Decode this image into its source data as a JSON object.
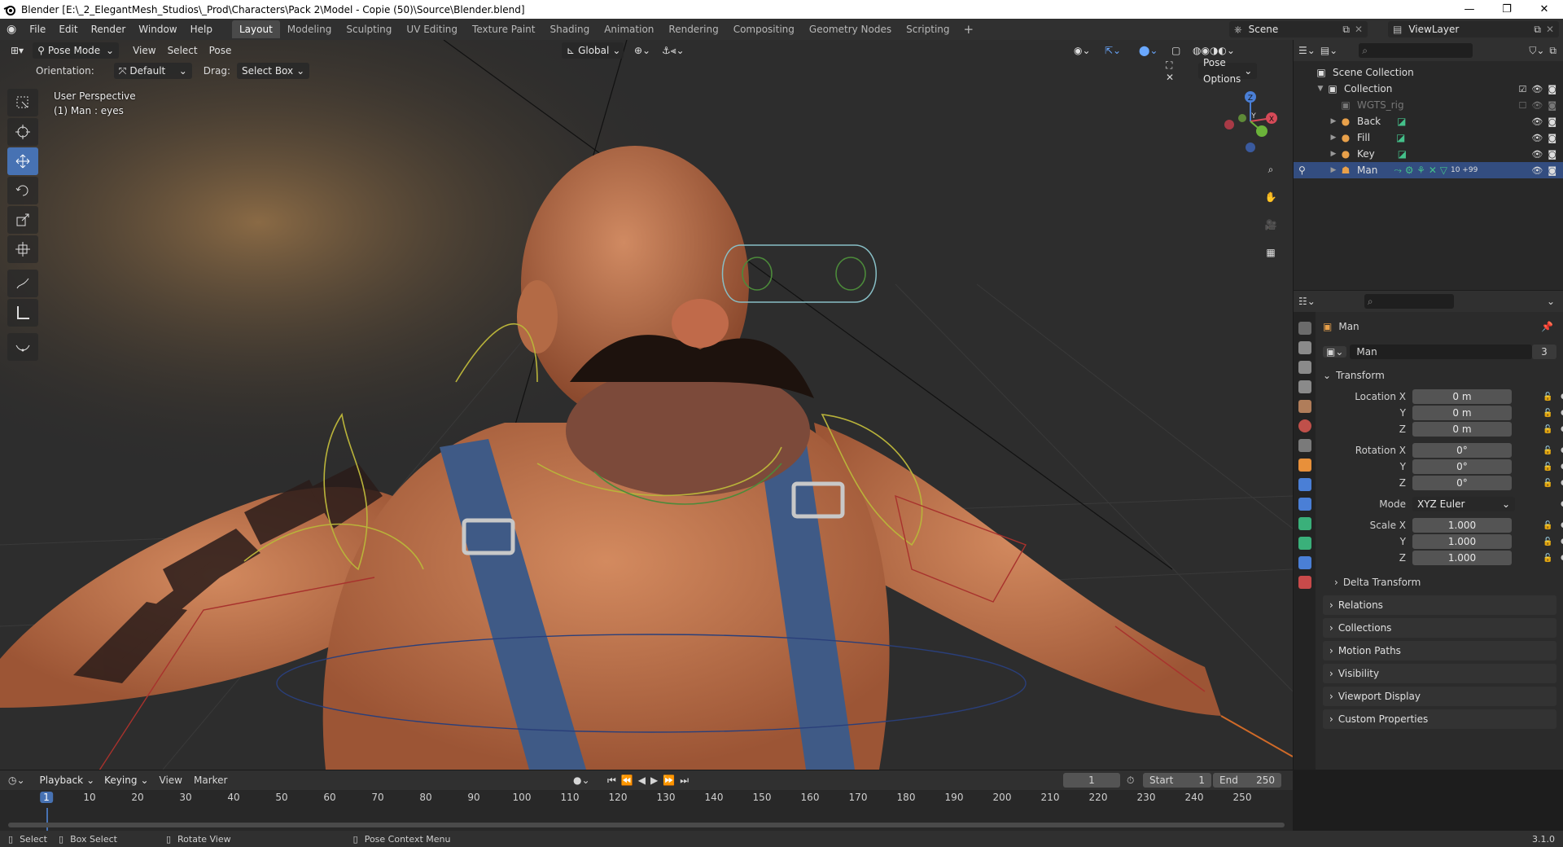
{
  "window": {
    "title": "Blender [E:\\_2_ElegantMesh_Studios\\_Prod\\Characters\\Pack 2\\Model - Copie (50)\\Source\\Blender.blend]",
    "buttons": [
      "—",
      "❐",
      "✕"
    ]
  },
  "menu": [
    "File",
    "Edit",
    "Render",
    "Window",
    "Help"
  ],
  "workspaces": [
    "Layout",
    "Modeling",
    "Sculpting",
    "UV Editing",
    "Texture Paint",
    "Shading",
    "Animation",
    "Rendering",
    "Compositing",
    "Geometry Nodes",
    "Scripting"
  ],
  "active_workspace": "Layout",
  "scene": {
    "name": "Scene",
    "view_layer": "ViewLayer"
  },
  "viewport_header": {
    "mode": "Pose Mode",
    "items": [
      "View",
      "Select",
      "Pose"
    ],
    "orientation_global": "Global",
    "pose_options": "Pose Options"
  },
  "tool_options": {
    "orientation_label": "Orientation:",
    "orientation_value": "Default",
    "drag_label": "Drag:",
    "drag_value": "Select Box"
  },
  "viewport_overlay": {
    "line1": "User Perspective",
    "line2": "(1) Man : eyes"
  },
  "gizmo": {
    "z": "Z",
    "y": "Y",
    "x": "X"
  },
  "outliner": {
    "rows": [
      {
        "label": "Scene Collection",
        "indent": 0
      },
      {
        "label": "Collection",
        "indent": 1
      },
      {
        "label": "WGTS_rig",
        "indent": 2
      },
      {
        "label": "Back",
        "indent": 2
      },
      {
        "label": "Fill",
        "indent": 2
      },
      {
        "label": "Key",
        "indent": 2
      },
      {
        "label": "Man",
        "indent": 2,
        "badge": "10 +99"
      }
    ]
  },
  "properties": {
    "object_name": "Man",
    "datablock_name": "Man",
    "datablock_users": "3",
    "transform_label": "Transform",
    "location": {
      "label": "Location X",
      "x": "0 m",
      "y": "0 m",
      "z": "0 m"
    },
    "rotation": {
      "label": "Rotation X",
      "x": "0°",
      "y": "0°",
      "z": "0°"
    },
    "mode_label": "Mode",
    "mode_value": "XYZ Euler",
    "scale": {
      "label": "Scale X",
      "x": "1.000",
      "y": "1.000",
      "z": "1.000"
    },
    "axis_y": "Y",
    "axis_z": "Z",
    "delta_transform": "Delta Transform",
    "sections": [
      "Relations",
      "Collections",
      "Motion Paths",
      "Visibility",
      "Viewport Display",
      "Custom Properties"
    ]
  },
  "timeline": {
    "menu": [
      "Playback",
      "Keying",
      "View",
      "Marker"
    ],
    "current_frame": "1",
    "start_label": "Start",
    "start": "1",
    "end_label": "End",
    "end": "250",
    "ruler": [
      "1",
      "10",
      "20",
      "30",
      "40",
      "50",
      "60",
      "70",
      "80",
      "90",
      "100",
      "110",
      "120",
      "130",
      "140",
      "150",
      "160",
      "170",
      "180",
      "190",
      "200",
      "210",
      "220",
      "230",
      "240",
      "250"
    ]
  },
  "statusbar": {
    "select": "Select",
    "box_select": "Box Select",
    "rotate_view": "Rotate View",
    "context_menu": "Pose Context Menu",
    "version": "3.1.0"
  }
}
